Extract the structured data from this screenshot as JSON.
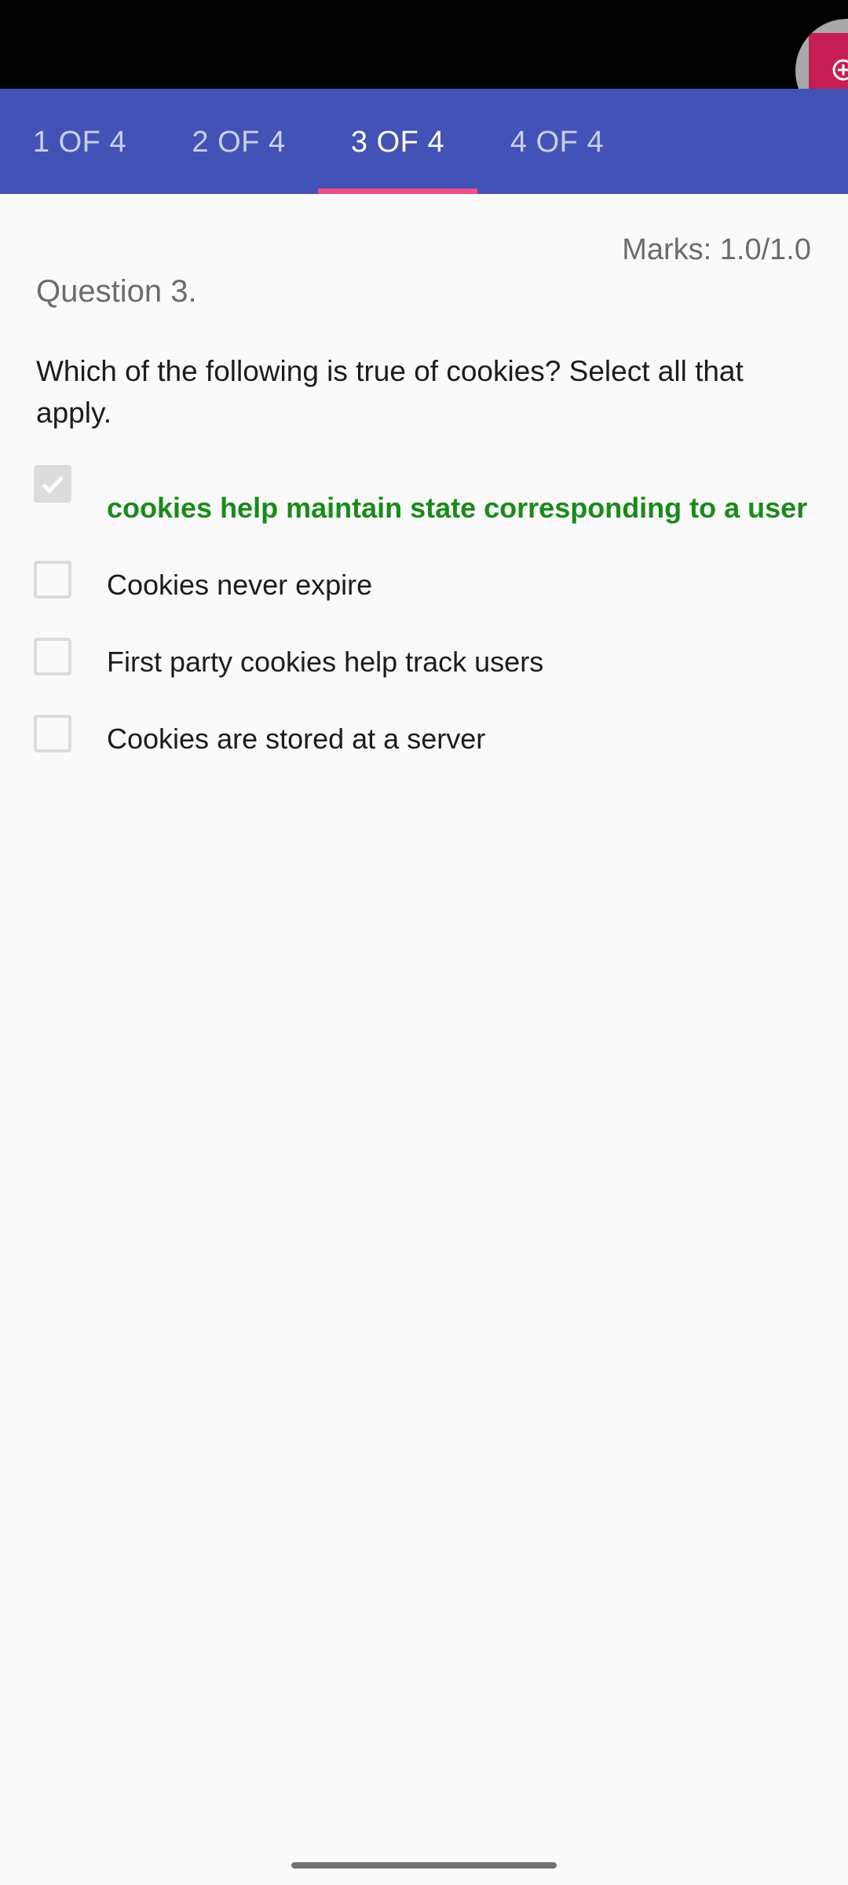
{
  "tabs": [
    {
      "label": "1 OF 4",
      "active": false
    },
    {
      "label": "2 OF 4",
      "active": false
    },
    {
      "label": "3 OF 4",
      "active": true
    },
    {
      "label": "4 OF 4",
      "active": false
    }
  ],
  "colors": {
    "tab_bar": "#4352b6",
    "tab_indicator": "#ee4f88",
    "correct_answer": "#1a8a1a"
  },
  "question": {
    "marks": "Marks: 1.0/1.0",
    "title": "Question 3.",
    "text": "Which of the following is true of cookies? Select all that apply.",
    "options": [
      {
        "label": "cookies help maintain state corresponding to a user",
        "checked": true,
        "correct": true
      },
      {
        "label": "Cookies never expire",
        "checked": false,
        "correct": false
      },
      {
        "label": "First party cookies help track users",
        "checked": false,
        "correct": false
      },
      {
        "label": "Cookies are stored at a server",
        "checked": false,
        "correct": false
      }
    ]
  },
  "floating_button": {
    "icon": "plus-circle-icon"
  }
}
